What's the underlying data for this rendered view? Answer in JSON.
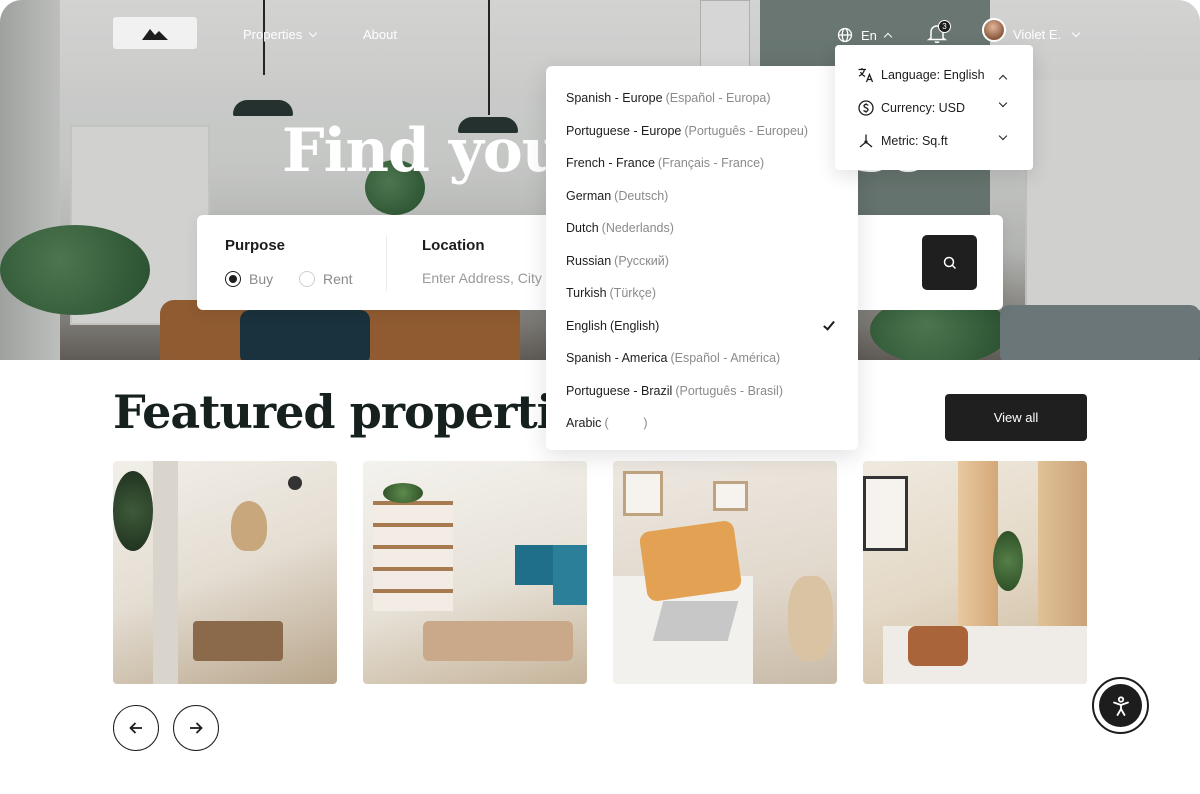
{
  "nav": {
    "logo_icon": "mountain-icon",
    "properties_label": "Properties",
    "about_label": "About",
    "language_label": "En",
    "notification_count": "3",
    "user_name": "Violet E."
  },
  "hero": {
    "title_visible": "Find your",
    "title_tail": "se"
  },
  "search": {
    "purpose_label": "Purpose",
    "buy_label": "Buy",
    "rent_label": "Rent",
    "selected_purpose": "Buy",
    "location_label": "Location",
    "location_placeholder": "Enter Address, City"
  },
  "language_menu": {
    "items": [
      {
        "name": "Spanish - Europe",
        "native": "(Español - Europa)"
      },
      {
        "name": "Portuguese - Europe",
        "native": "(Português - Europeu)"
      },
      {
        "name": "French - France",
        "native": "(Français - France)"
      },
      {
        "name": "German",
        "native": "(Deutsch)"
      },
      {
        "name": "Dutch",
        "native": "(Nederlands)"
      },
      {
        "name": "Russian",
        "native": "(Русский)"
      },
      {
        "name": "Turkish",
        "native": "(Türkçe)"
      },
      {
        "name": "English",
        "native": "(English)",
        "selected": true
      },
      {
        "name": "Spanish - America",
        "native": "(Español - América)"
      },
      {
        "name": "Portuguese - Brazil",
        "native": "(Português - Brasil)"
      },
      {
        "name": "Arabic",
        "native": "(          )"
      }
    ]
  },
  "settings_menu": {
    "language": "Language: English",
    "currency": "Currency: USD",
    "metric": "Metric: Sq.ft"
  },
  "featured": {
    "title": "Featured properties",
    "view_all_label": "View all"
  },
  "colors": {
    "primary_dark": "#1f1f1f",
    "heading": "#16211f",
    "muted_text": "#8a8a8a"
  }
}
